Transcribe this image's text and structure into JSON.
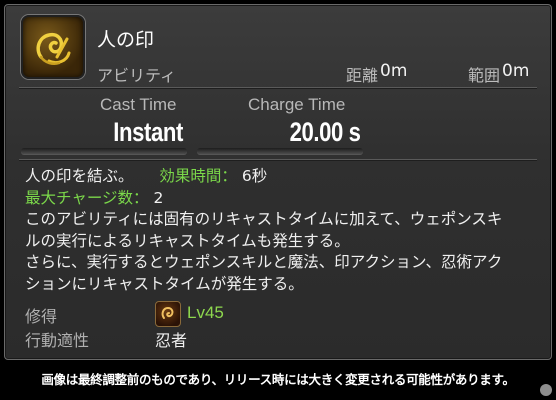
{
  "action": {
    "name": "人の印",
    "category": "アビリティ",
    "icon": "ten-mudra-icon",
    "range": {
      "label": "距離",
      "value": "0m"
    },
    "radius": {
      "label": "範囲",
      "value": "0m"
    }
  },
  "stats": {
    "cast": {
      "label": "Cast Time",
      "value": "Instant"
    },
    "recast": {
      "label": "Charge Time",
      "value": "20.00 s"
    }
  },
  "description": {
    "line1": "人の印を結ぶ。",
    "duration_label": "効果時間：",
    "duration_value": "6秒",
    "charges_label": "最大チャージ数：",
    "charges_value": "2",
    "line3": "このアビリティには固有のリキャストタイムに加えて、ウェポンスキ",
    "line4": "ルの実行によるリキャストタイムも発生する。",
    "line5": "さらに、実行するとウェポンスキルと魔法、印アクション、忍術アク",
    "line6": "ションにリキャストタイムが発生する。"
  },
  "meta": {
    "acquired_label": "修得",
    "acquired_level": "Lv45",
    "job_icon": "ninja-job-icon",
    "affinity_label": "行動適性",
    "affinity_value": "忍者"
  },
  "footer": "画像は最終調整前のものであり、リリース時には大きく変更される可能性があります。",
  "colors": {
    "highlight": "#7bd84a",
    "level": "#8ed84e",
    "background": "#2f2f2f"
  }
}
